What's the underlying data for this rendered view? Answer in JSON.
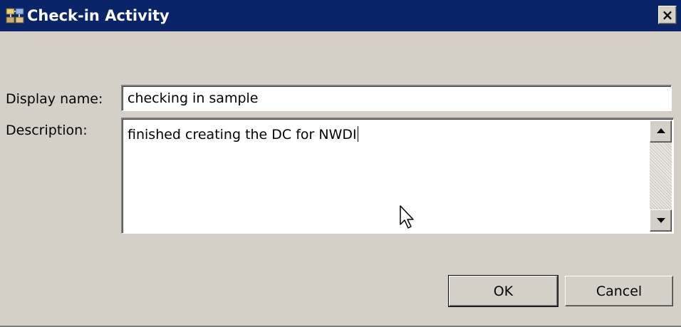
{
  "window": {
    "title": "Check-in Activity",
    "close_label": "×"
  },
  "form": {
    "display_name_label": "Display name:",
    "display_name_value": "checking in sample",
    "description_label": "Description:",
    "description_value": "finished creating the DC for NWDI"
  },
  "buttons": {
    "ok_label": "OK",
    "cancel_label": "Cancel"
  },
  "icons": {
    "title_icon": "check-in-activity-icon",
    "close": "close-icon",
    "scroll_up": "scroll-up-arrow-icon",
    "scroll_down": "scroll-down-arrow-icon",
    "cursor": "mouse-pointer-icon"
  },
  "colors": {
    "titlebar": "#0a246a",
    "dialog_bg": "#d4d0c8"
  }
}
